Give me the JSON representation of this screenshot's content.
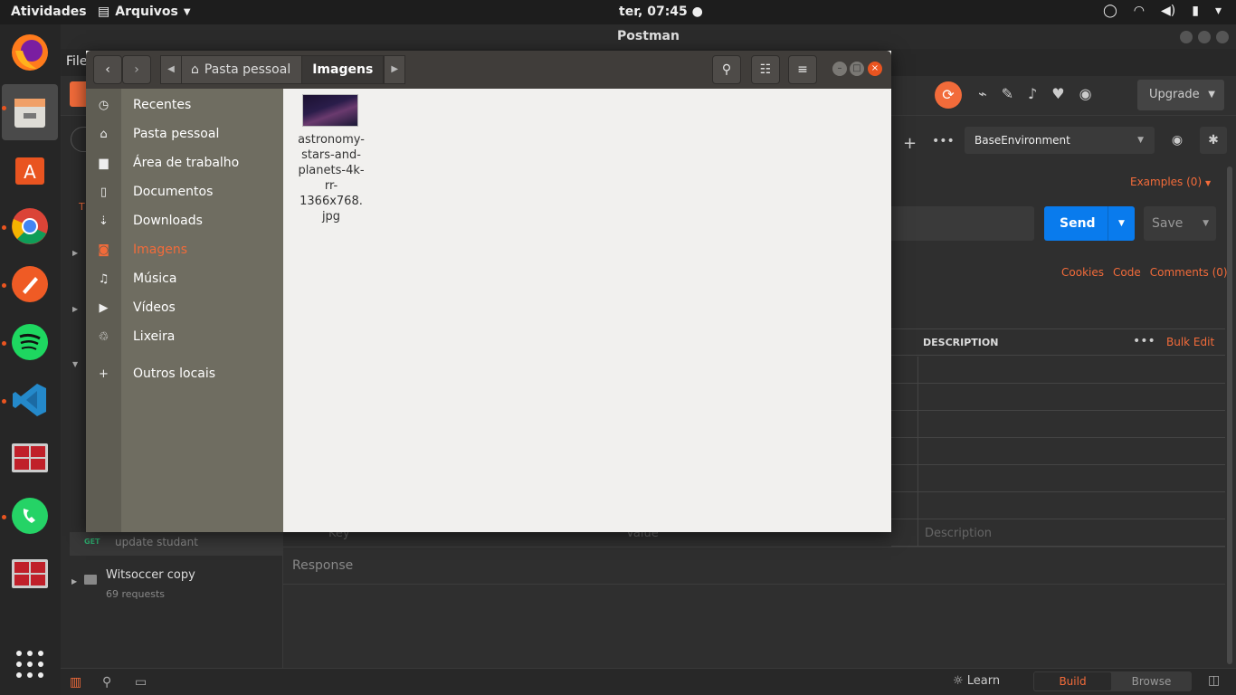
{
  "topbar": {
    "activities": "Atividades",
    "app_menu": "Arquivos",
    "clock": "ter, 07:45"
  },
  "postman": {
    "window_title": "Postman",
    "menu_file": "File",
    "upgrade_label": "Upgrade",
    "environment": "BaseEnvironment",
    "examples_label": "Examples (0)",
    "send_label": "Send",
    "save_label": "Save",
    "links": [
      "Cookies",
      "Code",
      "Comments (0)"
    ],
    "params_header": {
      "description": "DESCRIPTION",
      "bulk_edit": "Bulk Edit"
    },
    "params_placeholder": {
      "key": "Key",
      "value": "Value",
      "description": "Description"
    },
    "response_label": "Response",
    "sidebar": {
      "tab_letter": "T",
      "request_method": "GET",
      "request_name": "update studant",
      "collection_name": "Witsoccer copy",
      "collection_count": "69 requests"
    },
    "statusbar": {
      "learn": "Learn",
      "build": "Build",
      "browse": "Browse"
    }
  },
  "filemanager": {
    "breadcrumb_home": "Pasta pessoal",
    "breadcrumb_current": "Imagens",
    "places": [
      {
        "label": "Recentes",
        "icon": "clock-icon"
      },
      {
        "label": "Pasta pessoal",
        "icon": "home-icon"
      },
      {
        "label": "Área de trabalho",
        "icon": "folder-icon"
      },
      {
        "label": "Documentos",
        "icon": "document-icon"
      },
      {
        "label": "Downloads",
        "icon": "download-icon"
      },
      {
        "label": "Imagens",
        "icon": "camera-icon",
        "selected": true
      },
      {
        "label": "Música",
        "icon": "music-icon"
      },
      {
        "label": "Vídeos",
        "icon": "video-icon"
      },
      {
        "label": "Lixeira",
        "icon": "trash-icon"
      },
      {
        "label": "Outros locais",
        "icon": "plus-icon"
      }
    ],
    "files": [
      {
        "name": "astronomy-stars-and-planets-4k-rr-1366x768.jpg",
        "name_lines": [
          "astronomy-",
          "stars-and-",
          "planets-4k-",
          "rr-",
          "1366x768.",
          "jpg"
        ]
      }
    ]
  },
  "colors": {
    "accent": "#e95420",
    "postman_orange": "#f26b3a",
    "send_blue": "#097bed"
  }
}
